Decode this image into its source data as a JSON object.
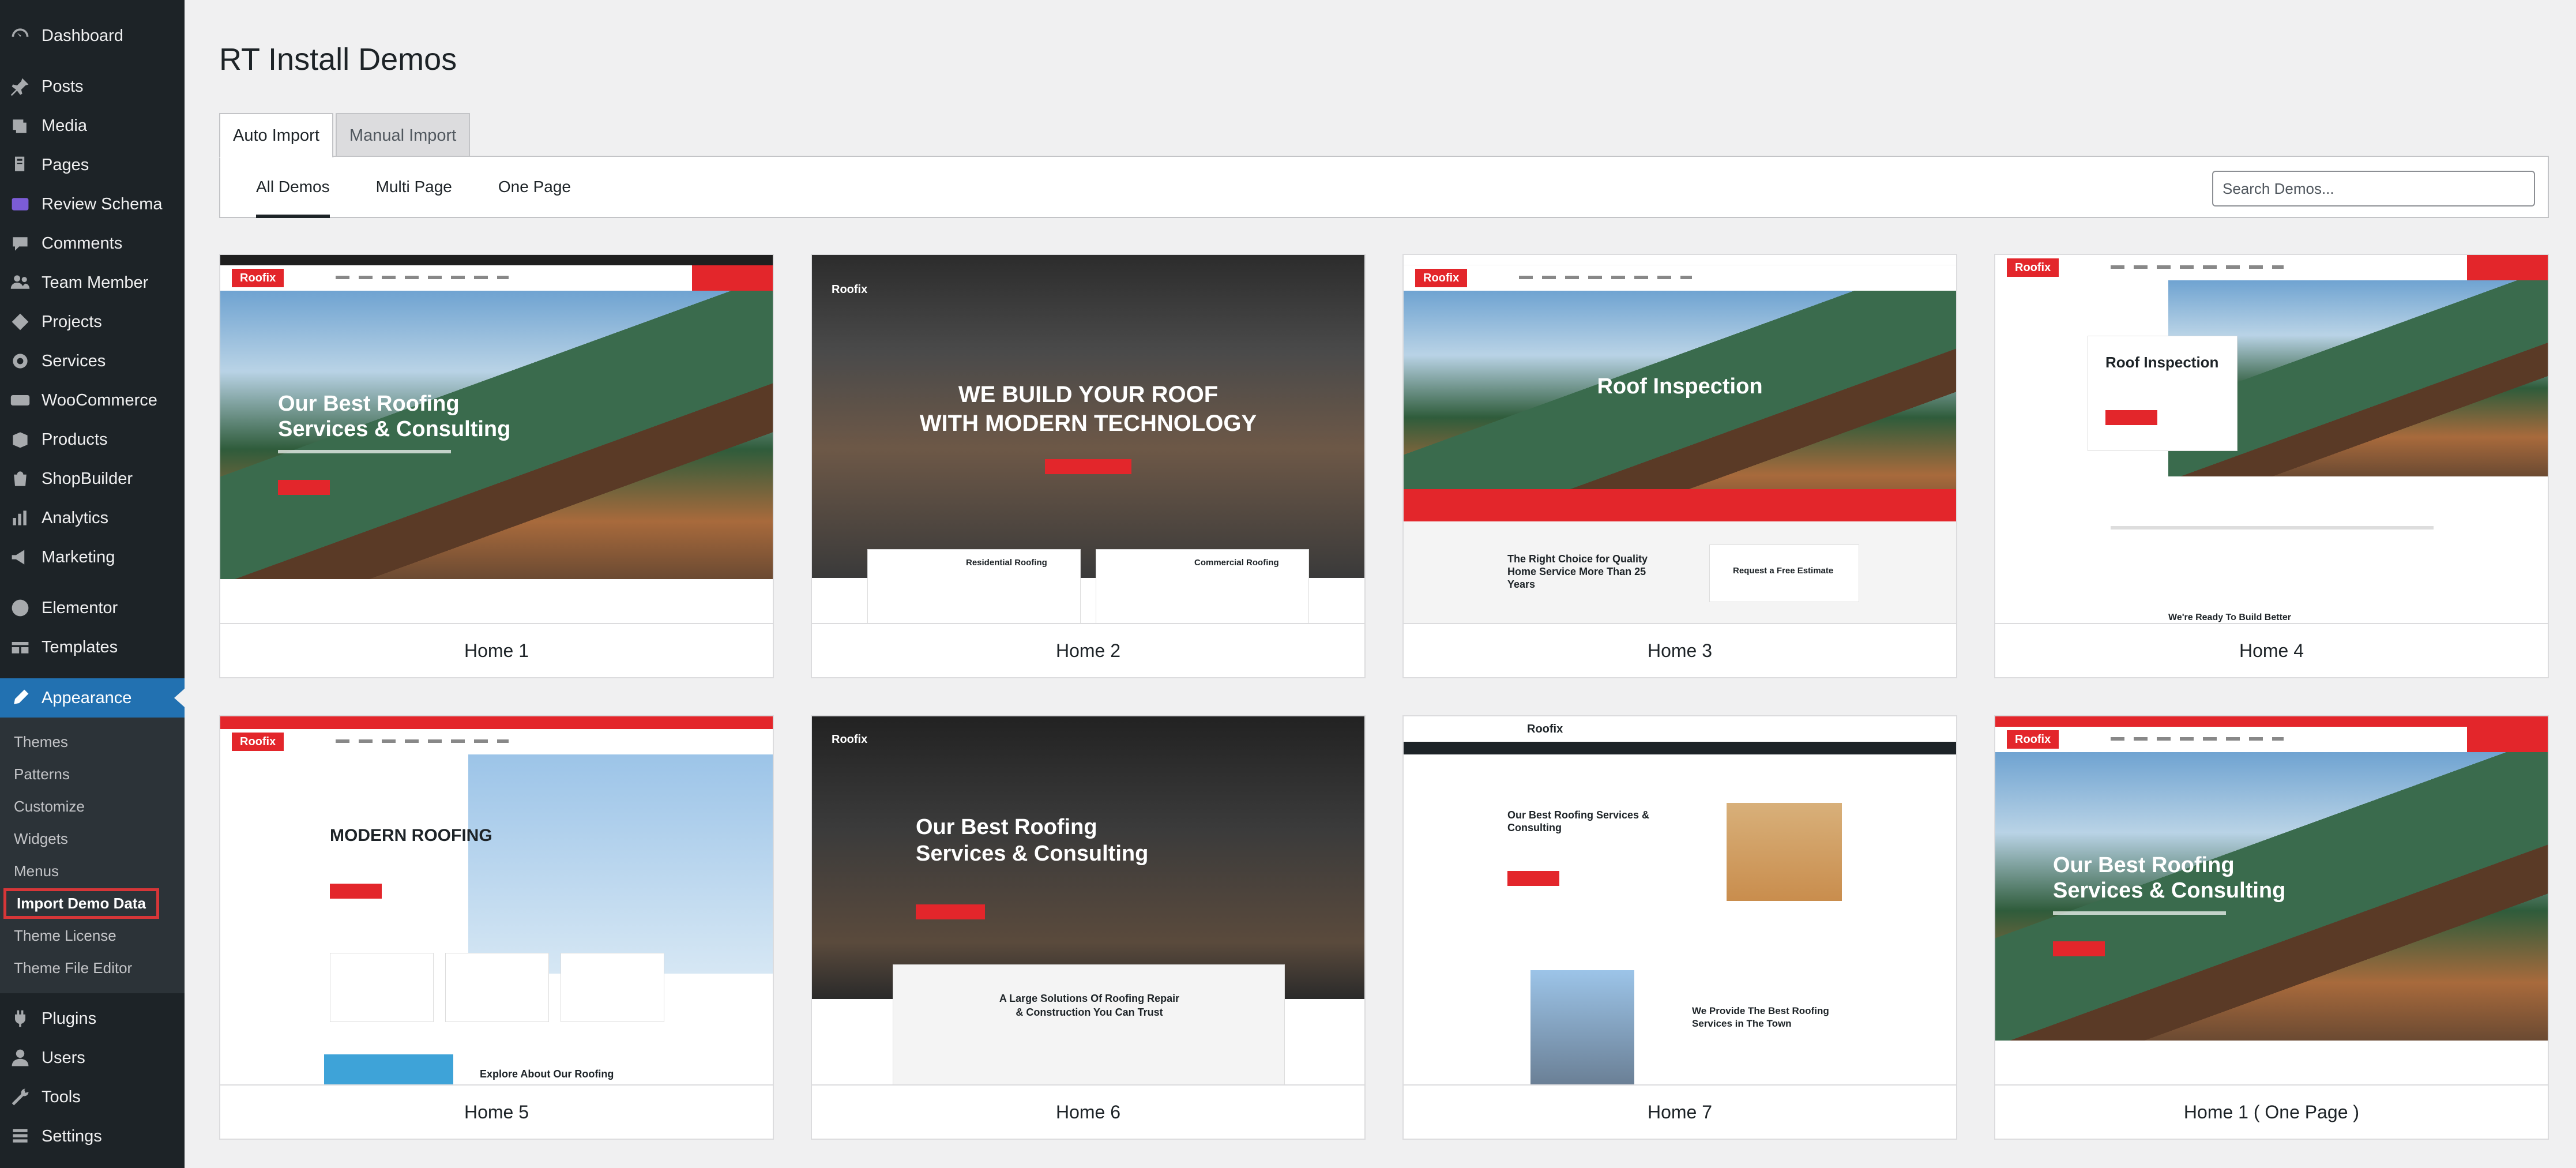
{
  "sidebar": {
    "items": [
      {
        "label": "Dashboard",
        "icon": "dashboard-icon"
      },
      {
        "label": "Posts",
        "icon": "pin-icon"
      },
      {
        "label": "Media",
        "icon": "media-icon"
      },
      {
        "label": "Pages",
        "icon": "pages-icon"
      },
      {
        "label": "Review Schema",
        "icon": "review-schema-icon"
      },
      {
        "label": "Comments",
        "icon": "comments-icon"
      },
      {
        "label": "Team Member",
        "icon": "team-icon"
      },
      {
        "label": "Projects",
        "icon": "projects-icon"
      },
      {
        "label": "Services",
        "icon": "services-icon"
      },
      {
        "label": "WooCommerce",
        "icon": "woocommerce-icon"
      },
      {
        "label": "Products",
        "icon": "products-icon"
      },
      {
        "label": "ShopBuilder",
        "icon": "shopbuilder-icon"
      },
      {
        "label": "Analytics",
        "icon": "analytics-icon"
      },
      {
        "label": "Marketing",
        "icon": "marketing-icon"
      },
      {
        "label": "Elementor",
        "icon": "elementor-icon"
      },
      {
        "label": "Templates",
        "icon": "templates-icon"
      },
      {
        "label": "Appearance",
        "icon": "appearance-icon"
      }
    ],
    "appearance_submenu": [
      "Themes",
      "Patterns",
      "Customize",
      "Widgets",
      "Menus",
      "Import Demo Data",
      "Theme License",
      "Theme File Editor"
    ],
    "bottom_items": [
      {
        "label": "Plugins",
        "icon": "plugins-icon"
      },
      {
        "label": "Users",
        "icon": "users-icon"
      },
      {
        "label": "Tools",
        "icon": "tools-icon"
      },
      {
        "label": "Settings",
        "icon": "settings-icon"
      }
    ]
  },
  "page": {
    "title": "RT Install Demos"
  },
  "tabs": [
    "Auto Import",
    "Manual Import"
  ],
  "filters": [
    "All Demos",
    "Multi Page",
    "One Page"
  ],
  "search": {
    "placeholder": "Search Demos..."
  },
  "demos": [
    {
      "label": "Home 1",
      "logo": "Roofix",
      "headline_1": "Our Best Roofing",
      "headline_2": "Services & Consulting"
    },
    {
      "label": "Home 2",
      "logo": "Roofix",
      "headline_1": "WE BUILD YOUR ROOF",
      "headline_2": "WITH MODERN TECHNOLOGY",
      "card_1": "Residential Roofing",
      "card_2": "Commercial Roofing"
    },
    {
      "label": "Home 3",
      "logo": "Roofix",
      "headline_1": "Roof Inspection",
      "bottom_1": "The Right Choice for Quality",
      "bottom_2": "Home Service More Than 25",
      "bottom_3": "Years",
      "cta": "Request a Free Estimate"
    },
    {
      "label": "Home 4",
      "logo": "Roofix",
      "headline_1": "Roof Inspection",
      "bottom_1": "We're Ready To Build Better"
    },
    {
      "label": "Home 5",
      "logo": "Roofix",
      "headline_1": "MODERN ROOFING",
      "bottom_1": "Explore About Our Roofing"
    },
    {
      "label": "Home 6",
      "logo": "Roofix",
      "headline_1": "Our Best Roofing",
      "headline_2": "Services & Consulting",
      "bottom_1": "A Large Solutions Of Roofing Repair",
      "bottom_2": "& Construction You Can Trust"
    },
    {
      "label": "Home 7",
      "logo": "Roofix",
      "headline_1": "Our Best Roofing Services &",
      "headline_2": "Consulting",
      "bottom_1": "We Provide The Best Roofing",
      "bottom_2": "Services in The Town"
    },
    {
      "label": "Home 1 ( One Page )",
      "logo": "Roofix",
      "headline_1": "Our Best Roofing",
      "headline_2": "Services & Consulting"
    }
  ],
  "colors": {
    "sidebar_bg": "#1d2327",
    "active_menu": "#2271b1",
    "brand_red": "#e3262b",
    "highlight_border": "#d63638"
  }
}
